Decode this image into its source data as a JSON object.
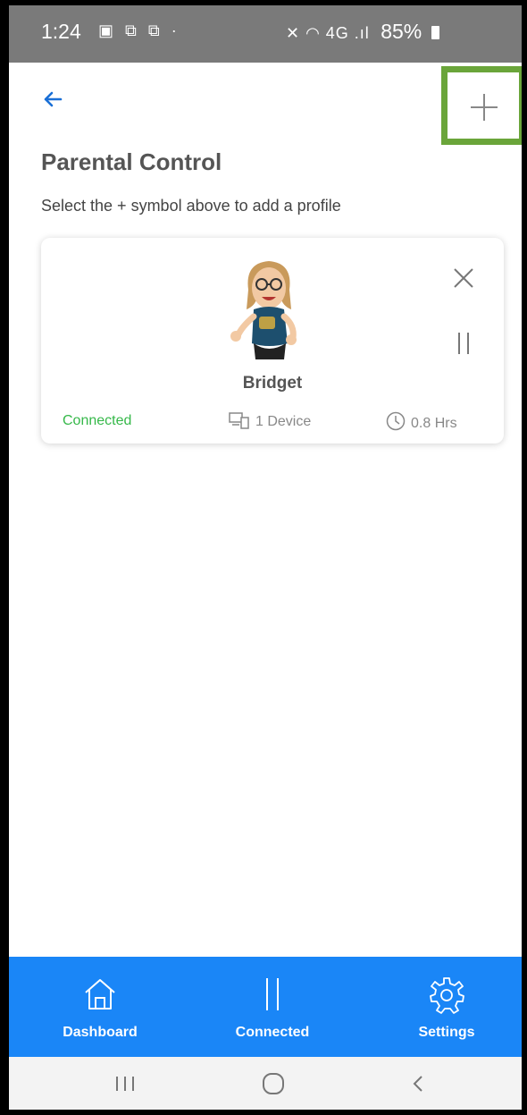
{
  "status_bar": {
    "time": "1:24",
    "left_icons": "▣ ⧉ ⧉ ·",
    "signal_icons": "✕ ◠ 4G .ıl",
    "battery_percent": "85%"
  },
  "header": {
    "back_icon": "arrow-left-icon",
    "add_icon": "plus-icon",
    "add_highlight_color": "#6aa53a",
    "title": "Parental Control",
    "hint": "Select the + symbol above to add a profile"
  },
  "profile_card": {
    "name": "Bridget",
    "status": "Connected",
    "devices": "1 Device",
    "time": "0.8 Hrs",
    "status_color": "#35b849"
  },
  "bottom_nav": {
    "background": "#1a86f7",
    "items": [
      {
        "label": "Dashboard",
        "icon": "home-icon"
      },
      {
        "label": "Connected",
        "icon": "pause-bars-icon"
      },
      {
        "label": "Settings",
        "icon": "gear-icon"
      }
    ]
  },
  "system_nav": {
    "recent_icon": "recent-apps-icon",
    "home_icon": "home-circle-icon",
    "back_icon": "back-chevron-icon"
  }
}
